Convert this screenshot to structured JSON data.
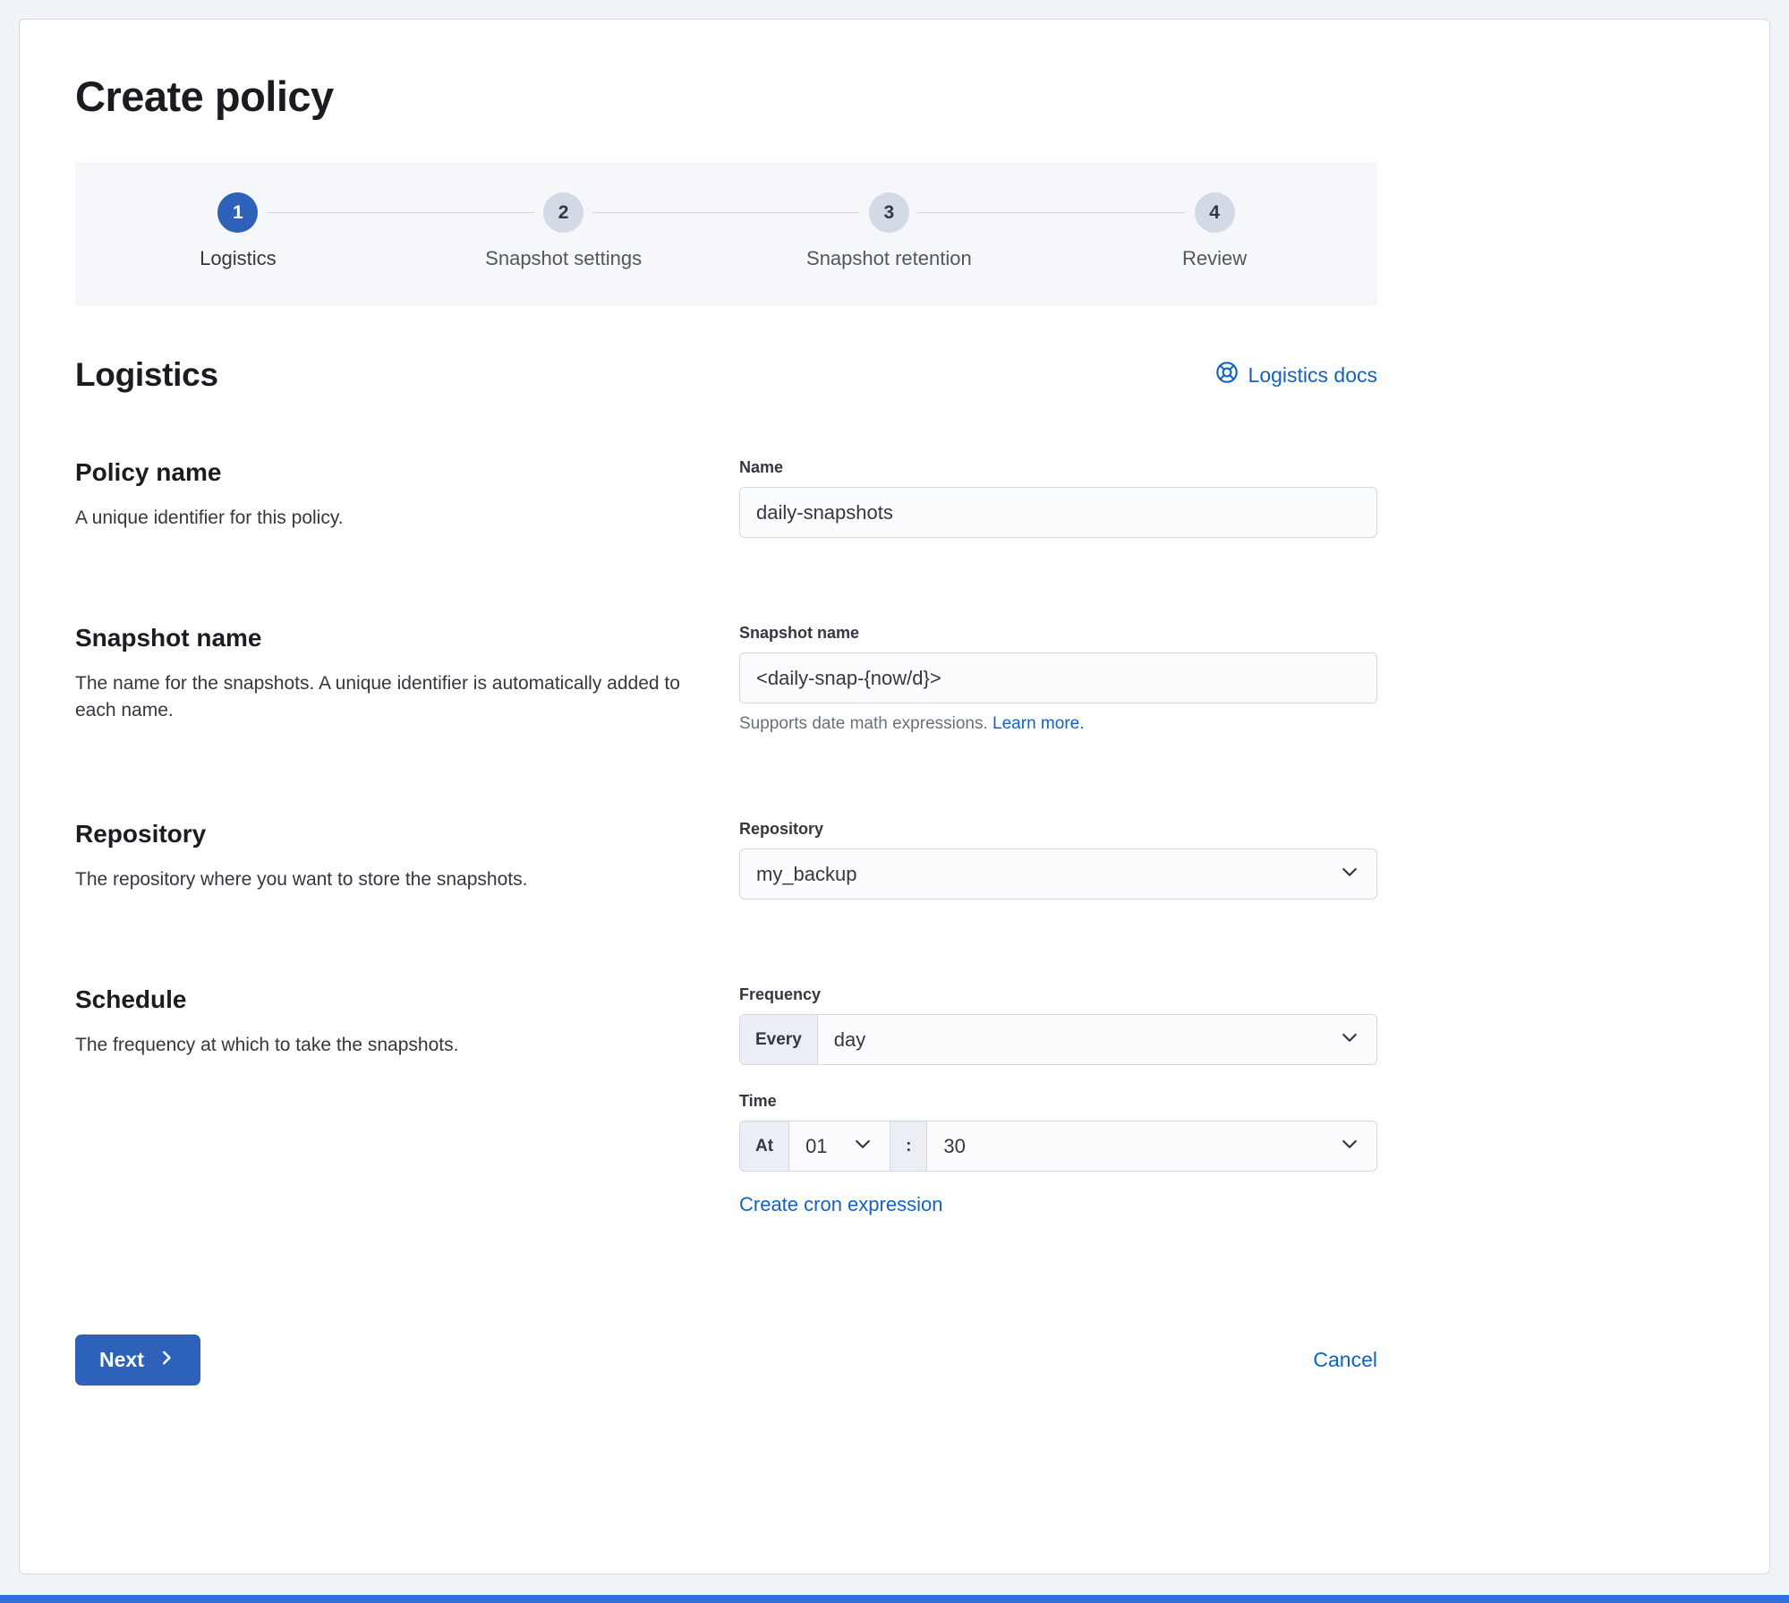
{
  "page": {
    "title": "Create policy"
  },
  "steps": [
    {
      "number": "1",
      "label": "Logistics",
      "state": "active"
    },
    {
      "number": "2",
      "label": "Snapshot settings",
      "state": "incomplete"
    },
    {
      "number": "3",
      "label": "Snapshot retention",
      "state": "incomplete"
    },
    {
      "number": "4",
      "label": "Review",
      "state": "incomplete"
    }
  ],
  "section": {
    "title": "Logistics",
    "docs_link": "Logistics docs"
  },
  "form": {
    "policy_name": {
      "heading": "Policy name",
      "description": "A unique identifier for this policy.",
      "label": "Name",
      "value": "daily-snapshots"
    },
    "snapshot_name": {
      "heading": "Snapshot name",
      "description": "The name for the snapshots. A unique identifier is automatically added to each name.",
      "label": "Snapshot name",
      "value": "<daily-snap-{now/d}>",
      "help_text": "Supports date math expressions.",
      "help_link": "Learn more."
    },
    "repository": {
      "heading": "Repository",
      "description": "The repository where you want to store the snapshots.",
      "label": "Repository",
      "value": "my_backup"
    },
    "schedule": {
      "heading": "Schedule",
      "description": "The frequency at which to take the snapshots.",
      "frequency_label": "Frequency",
      "frequency_prepend": "Every",
      "frequency_value": "day",
      "time_label": "Time",
      "time_prepend": "At",
      "hour_value": "01",
      "separator": ":",
      "minute_value": "30",
      "cron_link": "Create cron expression"
    }
  },
  "footer": {
    "next_label": "Next",
    "cancel_label": "Cancel"
  },
  "colors": {
    "primary": "#2e61ba",
    "link": "#1262c4",
    "bottom_bar": "#2f6fe0",
    "stepper_bg": "#f5f7fa",
    "step_inactive_bg": "#d3dae6",
    "input_border": "#d2d9e4",
    "input_bg": "#fbfcfd",
    "prepend_bg": "#ebeff5",
    "heading": "#1a1c21",
    "body_text": "#343741",
    "muted": "#69707d",
    "page_bg": "#f0f3f8",
    "card_border": "#d3dae6"
  }
}
